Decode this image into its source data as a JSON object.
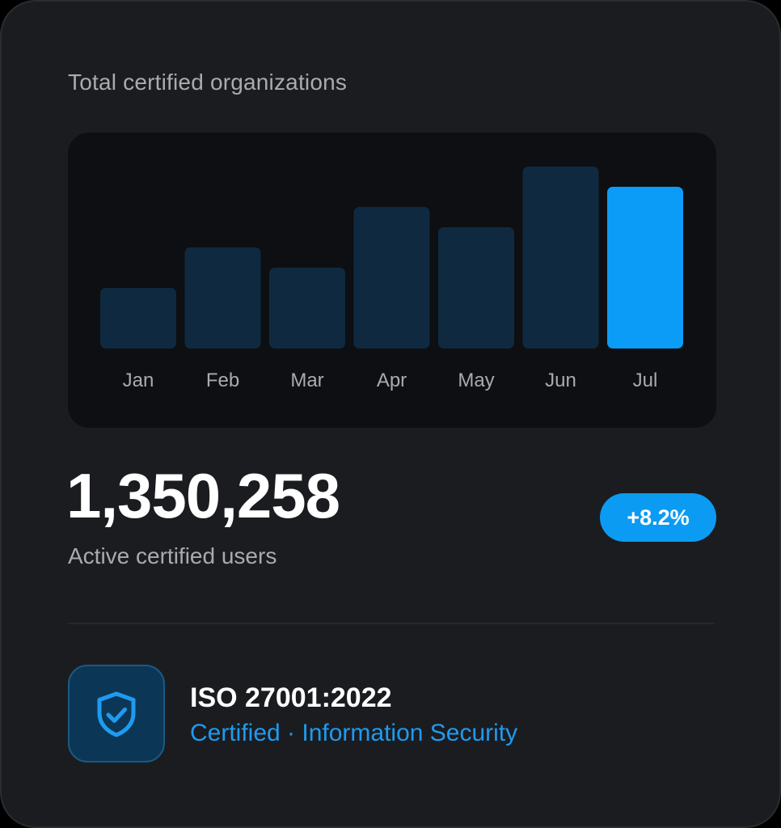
{
  "card": {
    "title": "Total certified organizations"
  },
  "chart_data": {
    "type": "bar",
    "categories": [
      "Jan",
      "Feb",
      "Mar",
      "Apr",
      "May",
      "Jun",
      "Jul"
    ],
    "values": [
      3.0,
      5.0,
      4.0,
      7.0,
      6.0,
      9.0,
      8.0
    ],
    "highlight_index": 6,
    "colors": {
      "bar": "#0f2a40",
      "highlight": "#0a9cf7",
      "tick_label": "#a9abb0"
    },
    "grid": false,
    "title": "",
    "xlabel": "",
    "ylabel": ""
  },
  "metric": {
    "value": "1,350,258",
    "label": "Active certified users",
    "delta": "+8.2%"
  },
  "certification": {
    "icon": "shield-check-icon",
    "title": "ISO 27001:2022",
    "subtitle": "Certified · Information Security"
  },
  "colors": {
    "accent": "#0c9bf2",
    "card_bg": "#1b1c20",
    "chart_bg": "#0e0f12"
  }
}
